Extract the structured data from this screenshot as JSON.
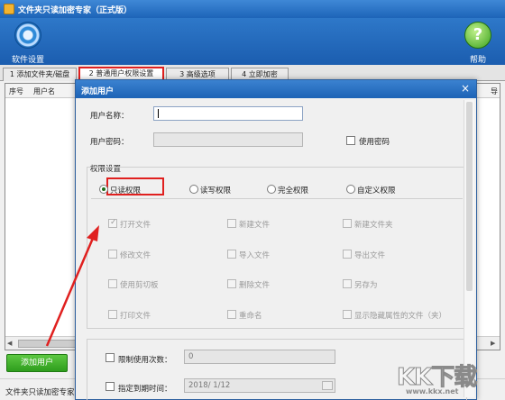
{
  "window": {
    "title": "文件夹只读加密专家（正式版）"
  },
  "toolbar": {
    "settings_label": "软件设置",
    "help_label": "帮助",
    "help_glyph": "?"
  },
  "tabs": [
    {
      "label": "1 添加文件夹/磁盘"
    },
    {
      "label": "2 普通用户权限设置"
    },
    {
      "label": "3 高级选项"
    },
    {
      "label": "4 立即加密"
    }
  ],
  "list": {
    "columns": [
      "序号",
      "用户名"
    ],
    "right_column_fragment": "导",
    "scroll_left": "◀",
    "scroll_right": "▶"
  },
  "add_user_button": "添加用户",
  "status_text": "文件夹只读加密专家",
  "dialog": {
    "title": "添加用户",
    "close_glyph": "×",
    "username_label": "用户名称：",
    "username_value": "",
    "password_label": "用户密码：",
    "use_password_label": "使用密码",
    "permission_group_title": "权限设置",
    "radios": [
      {
        "label": "只读权限",
        "selected": true
      },
      {
        "label": "读写权限",
        "selected": false
      },
      {
        "label": "完全权限",
        "selected": false
      },
      {
        "label": "自定义权限",
        "selected": false
      }
    ],
    "permissions": [
      {
        "label": "打开文件",
        "checked": true
      },
      {
        "label": "新建文件",
        "checked": false
      },
      {
        "label": "新建文件夹",
        "checked": false
      },
      {
        "label": "修改文件",
        "checked": false
      },
      {
        "label": "导入文件",
        "checked": false
      },
      {
        "label": "导出文件",
        "checked": false
      },
      {
        "label": "使用剪切板",
        "checked": false
      },
      {
        "label": "删除文件",
        "checked": false
      },
      {
        "label": "另存为",
        "checked": false
      },
      {
        "label": "打印文件",
        "checked": false
      },
      {
        "label": "重命名",
        "checked": false
      },
      {
        "label": "显示隐藏属性的文件（夹）",
        "checked": false
      }
    ],
    "limit_uses_label": "限制使用次数：",
    "limit_uses_value": "0",
    "expire_label": "指定到期时间：",
    "expire_value": "2018/ 1/12"
  },
  "watermark": {
    "logo": "KK下载",
    "url": "www.kkx.net"
  },
  "colors": {
    "highlight_red": "#e0201f",
    "toolbar_blue": "#1d64b8",
    "add_button_green": "#2e9d1d"
  }
}
